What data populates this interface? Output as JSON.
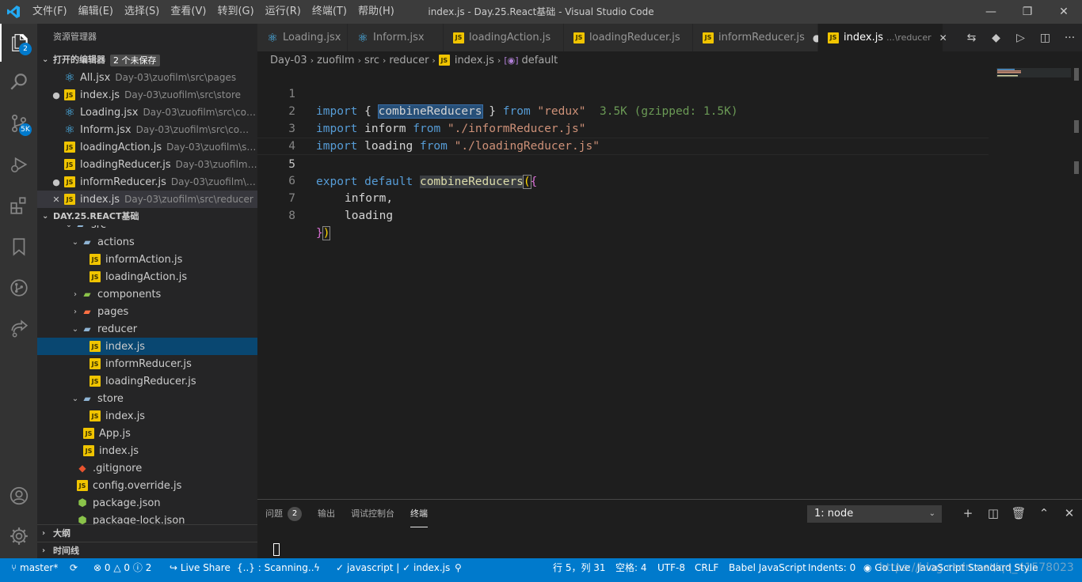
{
  "titlebar": {
    "menus": [
      "文件(F)",
      "编辑(E)",
      "选择(S)",
      "查看(V)",
      "转到(G)",
      "运行(R)",
      "终端(T)",
      "帮助(H)"
    ],
    "title": "index.js - Day.25.React基础 - Visual Studio Code",
    "minimize": "—",
    "restore": "❐",
    "close": "✕"
  },
  "activity": {
    "explorer_badge": "2",
    "scm_badge": "5K"
  },
  "sidebar": {
    "title": "资源管理器",
    "open_editors": {
      "header": "打开的编辑器",
      "badge": "2 个未保存",
      "items": [
        {
          "name": "All.jsx",
          "desc": "Day-03\\zuofilm\\src\\pages",
          "mark": ""
        },
        {
          "name": "index.js",
          "desc": "Day-03\\zuofilm\\src\\store",
          "mark": "●"
        },
        {
          "name": "Loading.jsx",
          "desc": "Day-03\\zuofilm\\src\\compo...",
          "mark": ""
        },
        {
          "name": "Inform.jsx",
          "desc": "Day-03\\zuofilm\\src\\compon...",
          "mark": ""
        },
        {
          "name": "loadingAction.js",
          "desc": "Day-03\\zuofilm\\src\\ac...",
          "mark": ""
        },
        {
          "name": "loadingReducer.js",
          "desc": "Day-03\\zuofilm\\src\\...",
          "mark": ""
        },
        {
          "name": "informReducer.js",
          "desc": "Day-03\\zuofilm\\src\\r...",
          "mark": "●"
        },
        {
          "name": "index.js",
          "desc": "Day-03\\zuofilm\\src\\reducer",
          "mark": "✕"
        }
      ]
    },
    "folder": {
      "header": "DAY.25.REACT基础",
      "items": [
        {
          "label": "src",
          "indent": 1,
          "twisty": "⌄"
        },
        {
          "label": "actions",
          "indent": 2,
          "twisty": "⌄"
        },
        {
          "label": "informAction.js",
          "indent": 3,
          "twisty": ""
        },
        {
          "label": "loadingAction.js",
          "indent": 3,
          "twisty": ""
        },
        {
          "label": "components",
          "indent": 2,
          "twisty": "›"
        },
        {
          "label": "pages",
          "indent": 2,
          "twisty": "›"
        },
        {
          "label": "reducer",
          "indent": 2,
          "twisty": "⌄"
        },
        {
          "label": "index.js",
          "indent": 3,
          "twisty": ""
        },
        {
          "label": "informReducer.js",
          "indent": 3,
          "twisty": ""
        },
        {
          "label": "loadingReducer.js",
          "indent": 3,
          "twisty": ""
        },
        {
          "label": "store",
          "indent": 2,
          "twisty": "⌄"
        },
        {
          "label": "index.js",
          "indent": 3,
          "twisty": ""
        },
        {
          "label": "App.js",
          "indent": 2,
          "twisty": ""
        },
        {
          "label": "index.js",
          "indent": 2,
          "twisty": ""
        },
        {
          "label": ".gitignore",
          "indent": 1,
          "twisty": ""
        },
        {
          "label": "config.override.js",
          "indent": 1,
          "twisty": ""
        },
        {
          "label": "package.json",
          "indent": 1,
          "twisty": ""
        },
        {
          "label": "package-lock.json",
          "indent": 1,
          "twisty": ""
        }
      ]
    },
    "outline": "大纲",
    "timeline": "时间线"
  },
  "tabs": [
    {
      "label": "Loading.jsx",
      "desc": "",
      "state": ""
    },
    {
      "label": "Inform.jsx",
      "desc": "",
      "state": ""
    },
    {
      "label": "loadingAction.js",
      "desc": "",
      "state": ""
    },
    {
      "label": "loadingReducer.js",
      "desc": "",
      "state": ""
    },
    {
      "label": "informReducer.js",
      "desc": "",
      "state": "●"
    },
    {
      "label": "index.js",
      "desc": "...\\reducer",
      "state": "✕"
    }
  ],
  "breadcrumb": [
    "Day-03",
    "zuofilm",
    "src",
    "reducer",
    "index.js",
    "default"
  ],
  "code": {
    "line_numbers": [
      "1",
      "2",
      "3",
      "4",
      "5",
      "6",
      "7",
      "8"
    ],
    "l1": {
      "import": "import",
      "ob": "{",
      "name": "combineReducers",
      "cb": "}",
      "from": "from",
      "src": "\"redux\"",
      "hint": "3.5K (gzipped: 1.5K)"
    },
    "l2": {
      "import": "import",
      "name": "inform",
      "from": "from",
      "src": "\"./informReducer.js\""
    },
    "l3": {
      "import": "import",
      "name": "loading",
      "from": "from",
      "src": "\"./loadingReducer.js\""
    },
    "l5": {
      "export": "export",
      "default": "default",
      "fn": "combineReducers",
      "paren": "(",
      "brace": "{"
    },
    "l6": "inform,",
    "l7": "loading",
    "l8": {
      "brace": "}",
      "paren": ")"
    }
  },
  "panel": {
    "tabs": [
      "问题",
      "输出",
      "调试控制台",
      "终端"
    ],
    "problems_count": "2",
    "terminal_select": "1: node"
  },
  "statusbar": {
    "branch": "master*",
    "sync": "⟳",
    "errors": "0",
    "warnings": "0",
    "info": "2",
    "live_share": "Live Share",
    "scanning": "{..} : Scanning..",
    "lang_filter": "javascript | ✓ index.js",
    "position": "行 5，列 31",
    "spaces": "空格: 4",
    "encoding": "UTF-8",
    "eol": "CRLF",
    "language": "Babel JavaScript",
    "indents": "Indents: 0",
    "go_live": "Go Live",
    "style": "JavaScript Standard Style"
  },
  "watermark": "https://blog.csdn.net/qq_41578023"
}
